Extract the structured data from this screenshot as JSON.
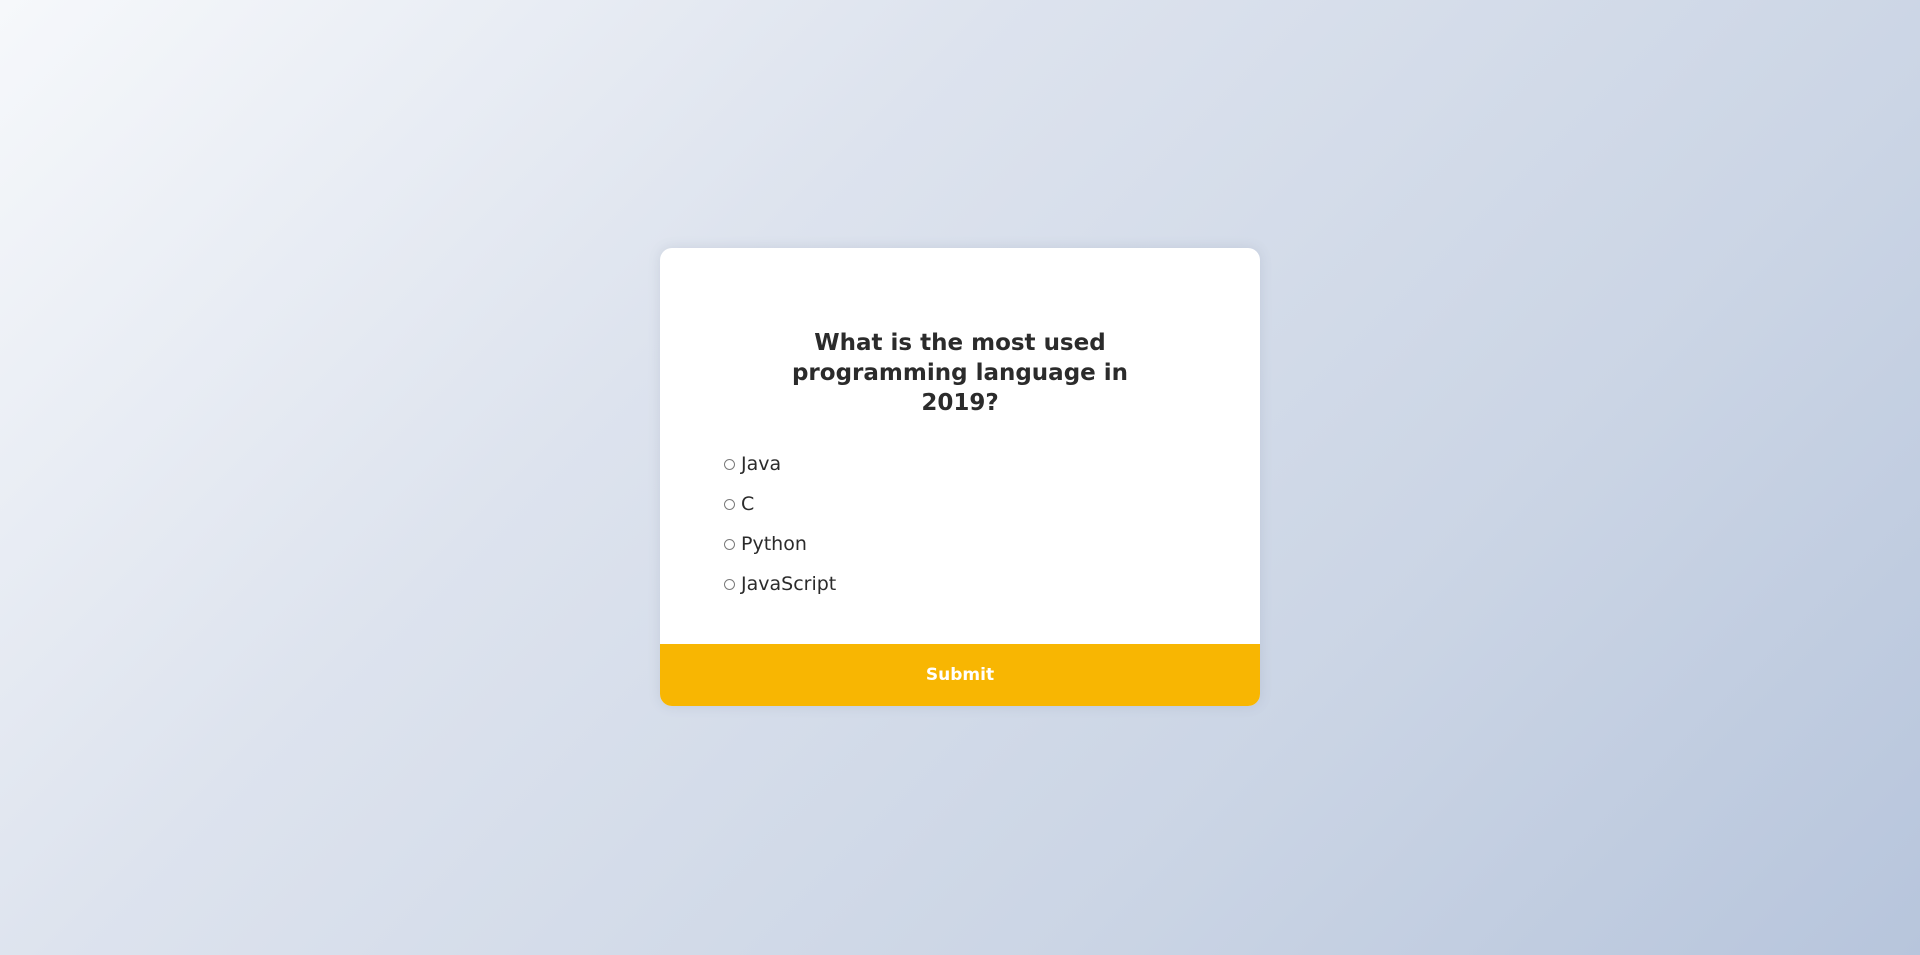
{
  "quiz": {
    "question": "What is the most used programming language in 2019?",
    "answers": [
      {
        "label": "Java",
        "selected": false
      },
      {
        "label": "C",
        "selected": false
      },
      {
        "label": "Python",
        "selected": false
      },
      {
        "label": "JavaScript",
        "selected": false
      }
    ],
    "submit_label": "Submit"
  },
  "colors": {
    "accent": "#f8b602",
    "card": "#ffffff",
    "text": "#2b2b2b"
  }
}
